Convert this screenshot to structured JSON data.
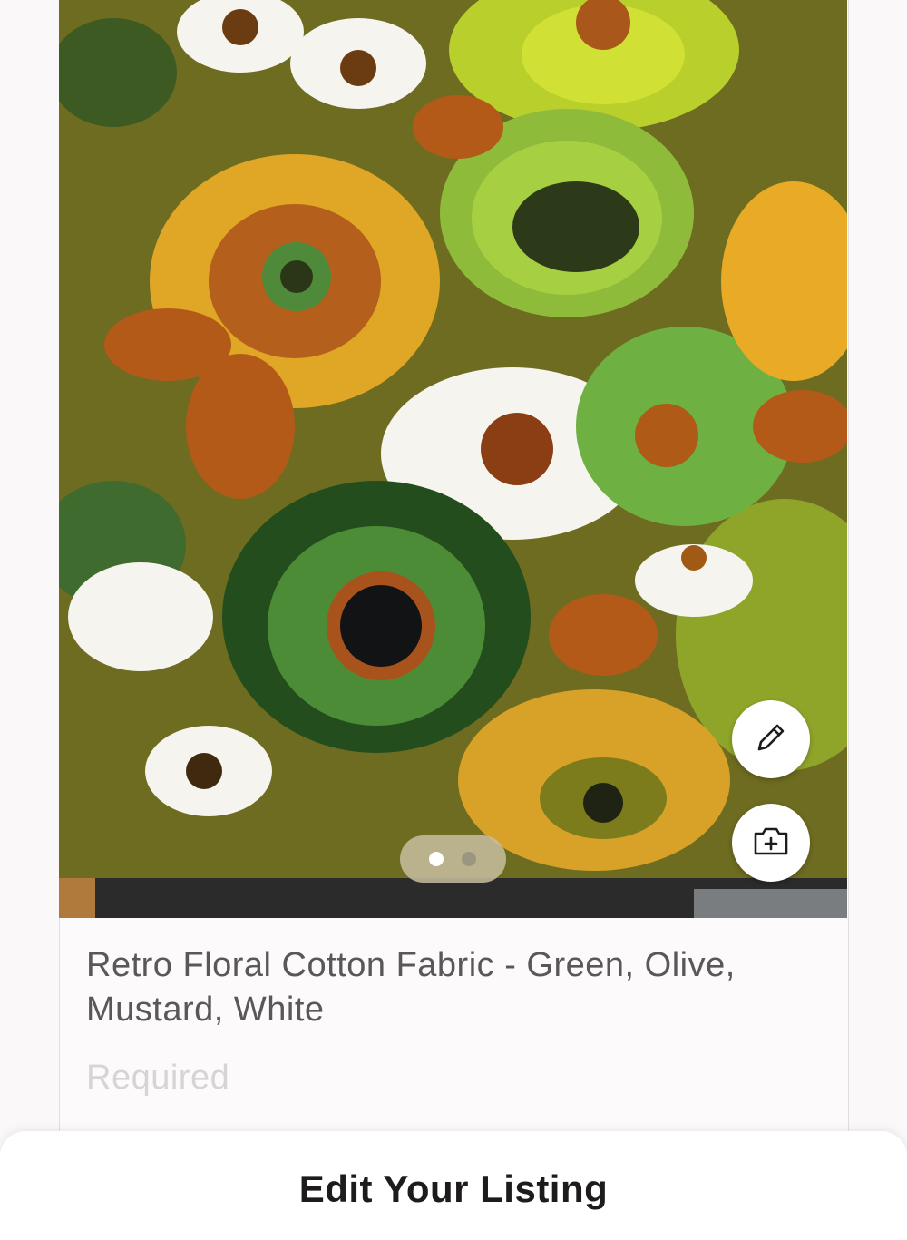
{
  "listing": {
    "title": "Retro Floral Cotton Fabric - Green, Olive, Mustard, White",
    "description_placeholder": "Required"
  },
  "gallery": {
    "photo_count": 2,
    "current_photo": 1
  },
  "actions": {
    "edit_icon": "pencil-icon",
    "camera_icon": "camera-add-icon"
  },
  "sheet": {
    "title": "Edit Your Listing"
  }
}
